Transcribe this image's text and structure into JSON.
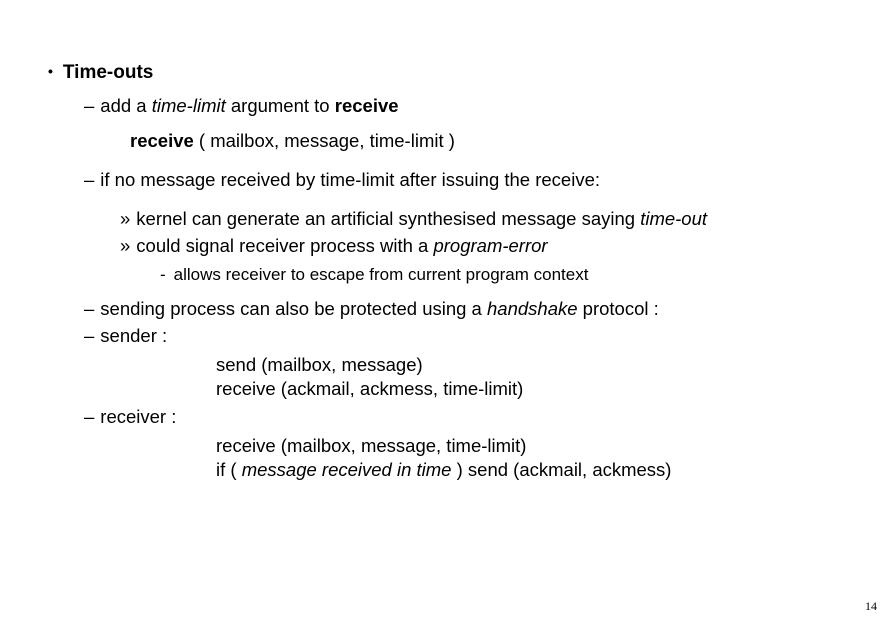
{
  "slide": {
    "title": "Time-outs",
    "line_add": {
      "pre": "add a ",
      "italic": "time-limit",
      "post": " argument to ",
      "bold": "receive"
    },
    "receive_sig": {
      "bold": "receive",
      "rest": " ( mailbox, message, time-limit )"
    },
    "line_ifno": "if no message received by time-limit after issuing the receive:",
    "sub_kernel": {
      "pre": "kernel can generate an artificial synthesised message saying ",
      "italic": "time-out"
    },
    "sub_signal": {
      "pre": "could signal receiver process with a ",
      "italic": "program-error"
    },
    "sub_allows": "allows receiver to escape from current program context",
    "line_sending": {
      "pre": "sending process can also be protected using a ",
      "italic": "handshake",
      "post": " protocol :"
    },
    "line_sender_label": "sender :",
    "sender_code1": "send (mailbox, message)",
    "sender_code2": "receive (ackmail, ackmess, time-limit)",
    "line_receiver_label": "receiver :",
    "receiver_code1": "receive (mailbox, message, time-limit)",
    "receiver_code2": {
      "pre": "if ( ",
      "italic": "message received in time",
      "post": " ) send (ackmail, ackmess)"
    }
  },
  "page_number": "14"
}
